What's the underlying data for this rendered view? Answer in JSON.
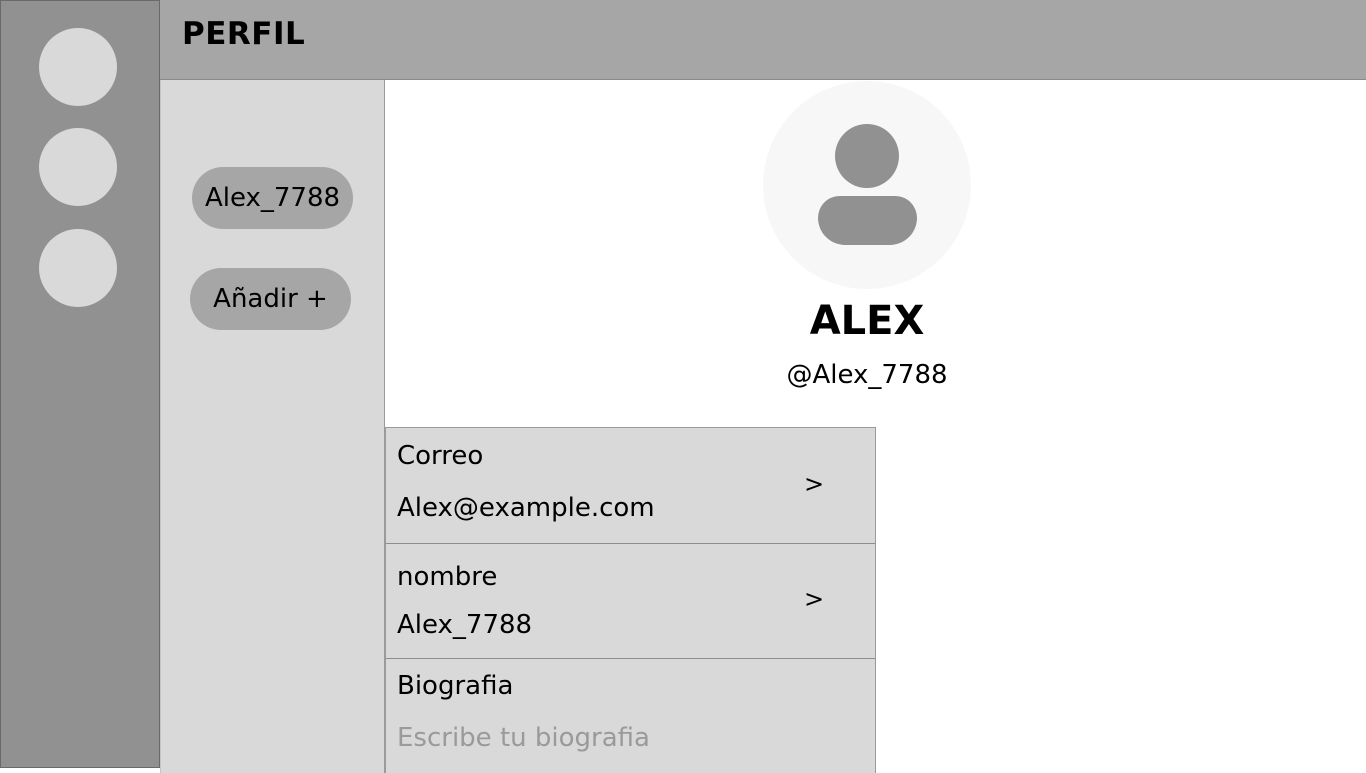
{
  "header": {
    "title": "PERFIL"
  },
  "rail": {
    "items": [
      {
        "icon": "circle-placeholder"
      },
      {
        "icon": "circle-placeholder"
      },
      {
        "icon": "circle-placeholder"
      }
    ]
  },
  "accounts": {
    "current_account_label": "Alex_7788",
    "add_label": "Añadir +"
  },
  "profile": {
    "avatar_icon": "user-avatar-icon",
    "display_name": "ALEX",
    "handle": "@Alex_7788"
  },
  "fields": {
    "email": {
      "label": "Correo",
      "value": "Alex@example.com",
      "chevron": ">"
    },
    "name": {
      "label": "nombre",
      "value": "Alex_7788",
      "chevron": ">"
    },
    "bio": {
      "label": "Biografia",
      "placeholder": "Escribe tu biografia"
    }
  },
  "colors": {
    "rail": "#919191",
    "header": "#a6a6a6",
    "panel": "#d9d9d9",
    "pill": "#a6a6a6",
    "avatar_bg": "#f7f7f7",
    "avatar_fg": "#919191",
    "placeholder_text": "#9a9a9a"
  }
}
